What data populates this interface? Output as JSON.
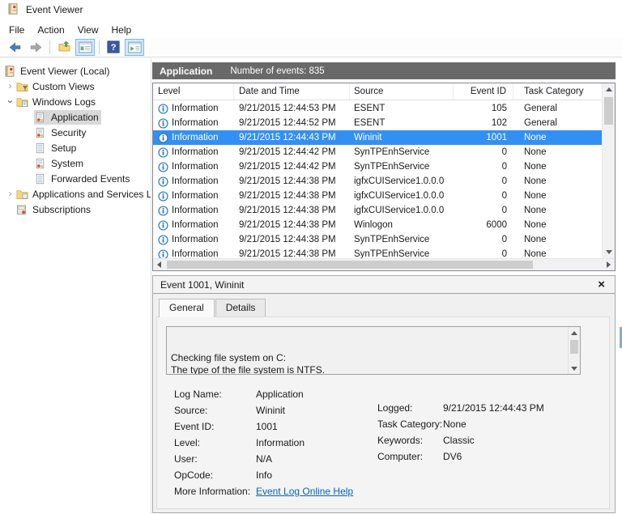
{
  "window": {
    "title": "Event Viewer"
  },
  "menubar": {
    "items": [
      "File",
      "Action",
      "View",
      "Help"
    ]
  },
  "toolbar": {
    "buttons": [
      {
        "name": "back",
        "icon": "back-arrow",
        "active": false,
        "separator_before": false
      },
      {
        "name": "forward",
        "icon": "forward-arrow",
        "active": false,
        "separator_before": false
      },
      {
        "name": "open-saved-log",
        "icon": "folder-up",
        "active": false,
        "separator_before": true
      },
      {
        "name": "toggle-console-tree",
        "icon": "console-tree",
        "active": true,
        "separator_before": false
      },
      {
        "name": "help",
        "icon": "help",
        "active": false,
        "separator_before": true
      },
      {
        "name": "toggle-action-pane",
        "icon": "action-pane",
        "active": true,
        "separator_before": false
      }
    ]
  },
  "sidebar": {
    "items": [
      {
        "label": "Event Viewer (Local)",
        "level": 0,
        "icon": "event-viewer",
        "expander": "none",
        "selected": false
      },
      {
        "label": "Custom Views",
        "level": 1,
        "icon": "folder-filter",
        "expander": "collapsed",
        "selected": false
      },
      {
        "label": "Windows Logs",
        "level": 1,
        "icon": "folder-logs",
        "expander": "expanded",
        "selected": false
      },
      {
        "label": "Application",
        "level": 2,
        "icon": "event-log",
        "expander": "none",
        "selected": true
      },
      {
        "label": "Security",
        "level": 2,
        "icon": "event-log",
        "expander": "none",
        "selected": false
      },
      {
        "label": "Setup",
        "level": 2,
        "icon": "plain-log",
        "expander": "none",
        "selected": false
      },
      {
        "label": "System",
        "level": 2,
        "icon": "event-log",
        "expander": "none",
        "selected": false
      },
      {
        "label": "Forwarded Events",
        "level": 2,
        "icon": "plain-log",
        "expander": "none",
        "selected": false
      },
      {
        "label": "Applications and Services Lo",
        "level": 1,
        "icon": "folder-apps",
        "expander": "collapsed",
        "selected": false
      },
      {
        "label": "Subscriptions",
        "level": 1,
        "icon": "subscriptions",
        "expander": "none",
        "selected": false
      }
    ]
  },
  "content_header": {
    "title": "Application",
    "subtitle": "Number of events: 835"
  },
  "event_table": {
    "columns": [
      "Level",
      "Date and Time",
      "Source",
      "Event ID",
      "Task Category"
    ],
    "rows": [
      {
        "level": "Information",
        "datetime": "9/21/2015 12:44:53 PM",
        "source": "ESENT",
        "event_id": "105",
        "task_category": "General",
        "selected": false
      },
      {
        "level": "Information",
        "datetime": "9/21/2015 12:44:52 PM",
        "source": "ESENT",
        "event_id": "102",
        "task_category": "General",
        "selected": false
      },
      {
        "level": "Information",
        "datetime": "9/21/2015 12:44:43 PM",
        "source": "Wininit",
        "event_id": "1001",
        "task_category": "None",
        "selected": true
      },
      {
        "level": "Information",
        "datetime": "9/21/2015 12:44:42 PM",
        "source": "SynTPEnhService",
        "event_id": "0",
        "task_category": "None",
        "selected": false
      },
      {
        "level": "Information",
        "datetime": "9/21/2015 12:44:42 PM",
        "source": "SynTPEnhService",
        "event_id": "0",
        "task_category": "None",
        "selected": false
      },
      {
        "level": "Information",
        "datetime": "9/21/2015 12:44:38 PM",
        "source": "igfxCUIService1.0.0.0",
        "event_id": "0",
        "task_category": "None",
        "selected": false
      },
      {
        "level": "Information",
        "datetime": "9/21/2015 12:44:38 PM",
        "source": "igfxCUIService1.0.0.0",
        "event_id": "0",
        "task_category": "None",
        "selected": false
      },
      {
        "level": "Information",
        "datetime": "9/21/2015 12:44:38 PM",
        "source": "igfxCUIService1.0.0.0",
        "event_id": "0",
        "task_category": "None",
        "selected": false
      },
      {
        "level": "Information",
        "datetime": "9/21/2015 12:44:38 PM",
        "source": "Winlogon",
        "event_id": "6000",
        "task_category": "None",
        "selected": false
      },
      {
        "level": "Information",
        "datetime": "9/21/2015 12:44:38 PM",
        "source": "SynTPEnhService",
        "event_id": "0",
        "task_category": "None",
        "selected": false
      },
      {
        "level": "Information",
        "datetime": "9/21/2015 12:44:38 PM",
        "source": "SynTPEnhService",
        "event_id": "0",
        "task_category": "None",
        "selected": false
      }
    ]
  },
  "preview_pane": {
    "title": "Event 1001, Wininit",
    "tabs": [
      {
        "label": "General",
        "active": true
      },
      {
        "label": "Details",
        "active": false
      }
    ],
    "message_lines": [
      "Checking file system on C:",
      "The type of the file system is NTFS."
    ],
    "fields_left": [
      {
        "label": "Log Name:",
        "value": "Application"
      },
      {
        "label": "Source:",
        "value": "Wininit"
      },
      {
        "label": "Event ID:",
        "value": "1001"
      },
      {
        "label": "Level:",
        "value": "Information"
      },
      {
        "label": "User:",
        "value": "N/A"
      },
      {
        "label": "OpCode:",
        "value": "Info"
      }
    ],
    "fields_right": [
      {
        "label": "Logged:",
        "value": "9/21/2015 12:44:43 PM"
      },
      {
        "label": "Task Category:",
        "value": "None"
      },
      {
        "label": "Keywords:",
        "value": "Classic"
      },
      {
        "label": "Computer:",
        "value": "DV6"
      }
    ],
    "more_information": {
      "label": "More Information:",
      "link": "Event Log Online Help"
    }
  },
  "colors": {
    "selection_blue": "#3390f3",
    "header_bar_gray": "#696969",
    "link_blue": "#0563c1",
    "toolbar_active_bg": "#d3e9fb"
  }
}
